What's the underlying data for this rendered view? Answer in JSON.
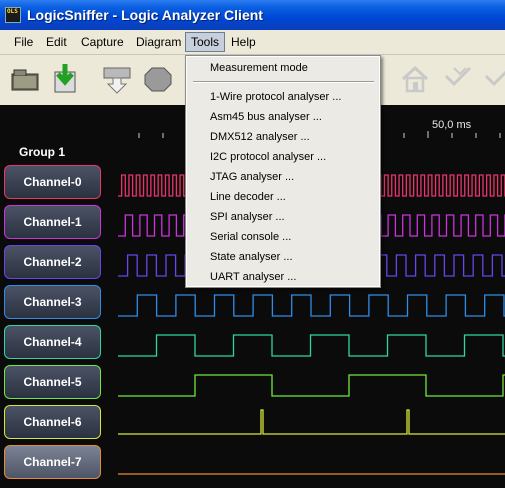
{
  "window": {
    "title": "LogicSniffer - Logic Analyzer Client",
    "icon_text": "OLS"
  },
  "menubar": {
    "items": [
      {
        "label": "File"
      },
      {
        "label": "Edit"
      },
      {
        "label": "Capture"
      },
      {
        "label": "Diagram"
      },
      {
        "label": "Tools"
      },
      {
        "label": "Help"
      }
    ]
  },
  "toolbar": {
    "buttons": [
      "open-icon",
      "save-icon",
      "capture-icon",
      "stop-icon",
      "home-icon",
      "zoom-in-icon",
      "zoom-out-icon"
    ]
  },
  "ruler": {
    "label": "50,0 ms"
  },
  "group": {
    "label": "Group 1"
  },
  "channels": [
    {
      "label": "Channel-0",
      "color": "#e8356c"
    },
    {
      "label": "Channel-1",
      "color": "#cc33dd"
    },
    {
      "label": "Channel-2",
      "color": "#6a44ee"
    },
    {
      "label": "Channel-3",
      "color": "#2f8de8"
    },
    {
      "label": "Channel-4",
      "color": "#2fd6a0"
    },
    {
      "label": "Channel-5",
      "color": "#6fe83e"
    },
    {
      "label": "Channel-6",
      "color": "#d6e63a"
    },
    {
      "label": "Channel-7",
      "color": "#e28c33"
    }
  ],
  "tools_menu": {
    "header_item": "Measurement mode",
    "items": [
      "1-Wire protocol analyser ...",
      "Asm45 bus analyser ...",
      "DMX512 analyser ...",
      "I2C protocol analyser ...",
      "JTAG analyser ...",
      "Line decoder ...",
      "SPI analyser ...",
      "Serial console ...",
      "State analyser ...",
      "UART analyser ..."
    ]
  }
}
